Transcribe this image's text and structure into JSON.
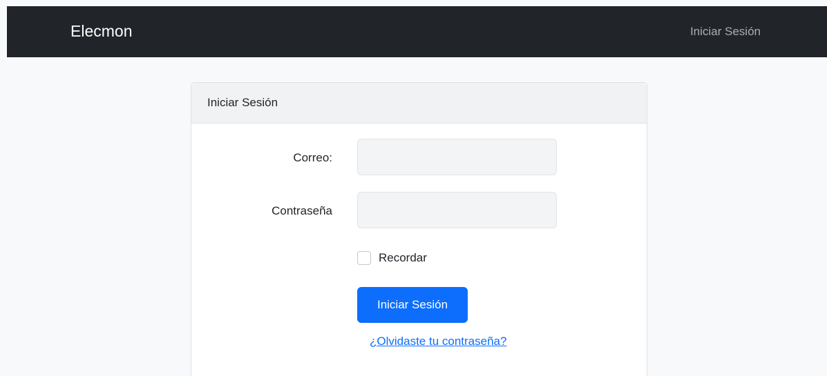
{
  "navbar": {
    "brand": "Elecmon",
    "login_link": "Iniciar Sesión"
  },
  "card": {
    "header": "Iniciar Sesión",
    "email_label": "Correo:",
    "email_value": "",
    "password_label": "Contraseña",
    "password_value": "",
    "remember_label": "Recordar",
    "remember_checked": false,
    "submit_label": "Iniciar Sesión",
    "forgot_link": "¿Olvidaste tu contraseña?"
  },
  "colors": {
    "navbar_bg": "#212529",
    "primary": "#0d6efd",
    "page_bg": "#f8f9fa"
  }
}
